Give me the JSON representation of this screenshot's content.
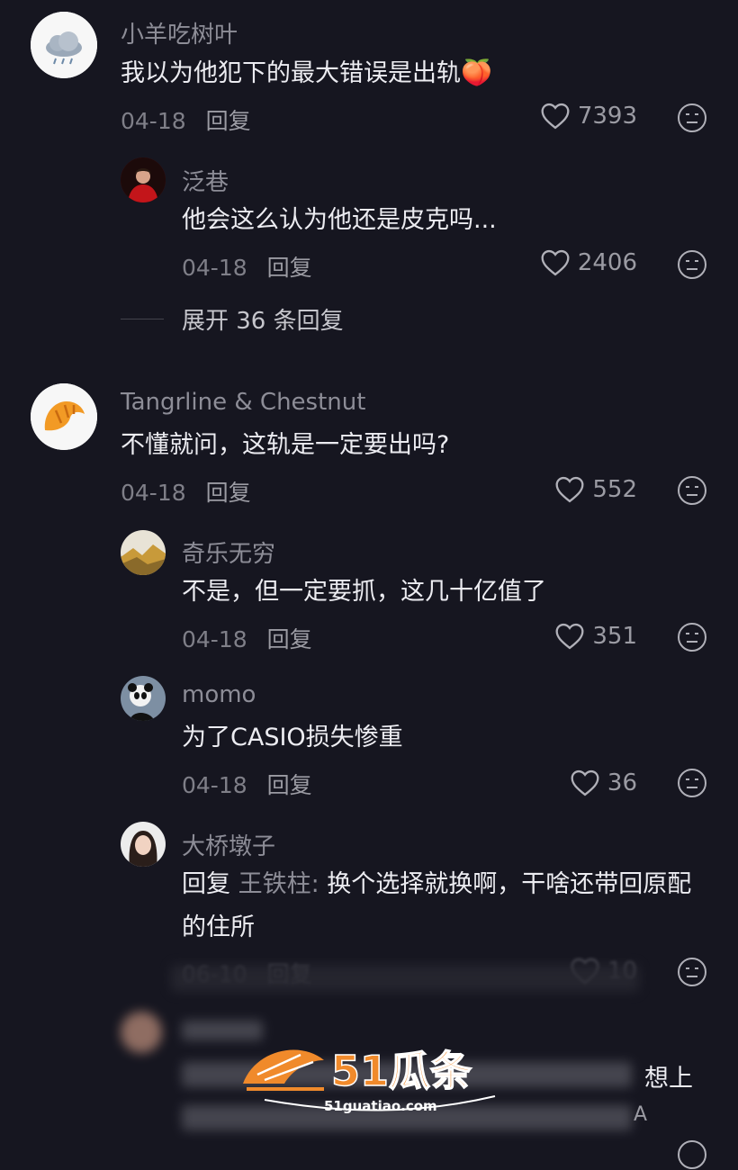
{
  "comments": [
    {
      "user": "小羊吃树叶",
      "text": "我以为他犯下的最大错误是出轨",
      "emoji": "🍑",
      "date": "04-18",
      "reply_label": "回复",
      "likes": "7393",
      "replies": [
        {
          "user": "泛巷",
          "text": "他会这么认为他还是皮克吗...",
          "date": "04-18",
          "reply_label": "回复",
          "likes": "2406"
        }
      ],
      "expand_label": "展开 36 条回复"
    },
    {
      "user": "Tangrline & Chestnut",
      "text": "不懂就问，这轨是一定要出吗?",
      "date": "04-18",
      "reply_label": "回复",
      "likes": "552",
      "replies": [
        {
          "user": "奇乐无穷",
          "text": "不是，但一定要抓，这几十亿值了",
          "date": "04-18",
          "reply_label": "回复",
          "likes": "351"
        },
        {
          "user": "momo",
          "text": "为了CASIO损失惨重",
          "date": "04-18",
          "reply_label": "回复",
          "likes": "36"
        },
        {
          "user": "大桥墩子",
          "reply_prefix": "回复",
          "mention": "王铁柱:",
          "text": "换个选择就换啊，干啥还带回原配的住所",
          "date": "06-10",
          "reply_label": "回复",
          "likes": "10"
        }
      ]
    }
  ],
  "partial_text": [
    "想上",
    "A"
  ],
  "watermark": {
    "brand": "51瓜条",
    "url": "51guatiao.com"
  },
  "icons": {
    "like": "heart-icon",
    "dislike": "dislike-face-icon"
  },
  "colors": {
    "background": "#161620",
    "watermark": "#f08a2b"
  }
}
